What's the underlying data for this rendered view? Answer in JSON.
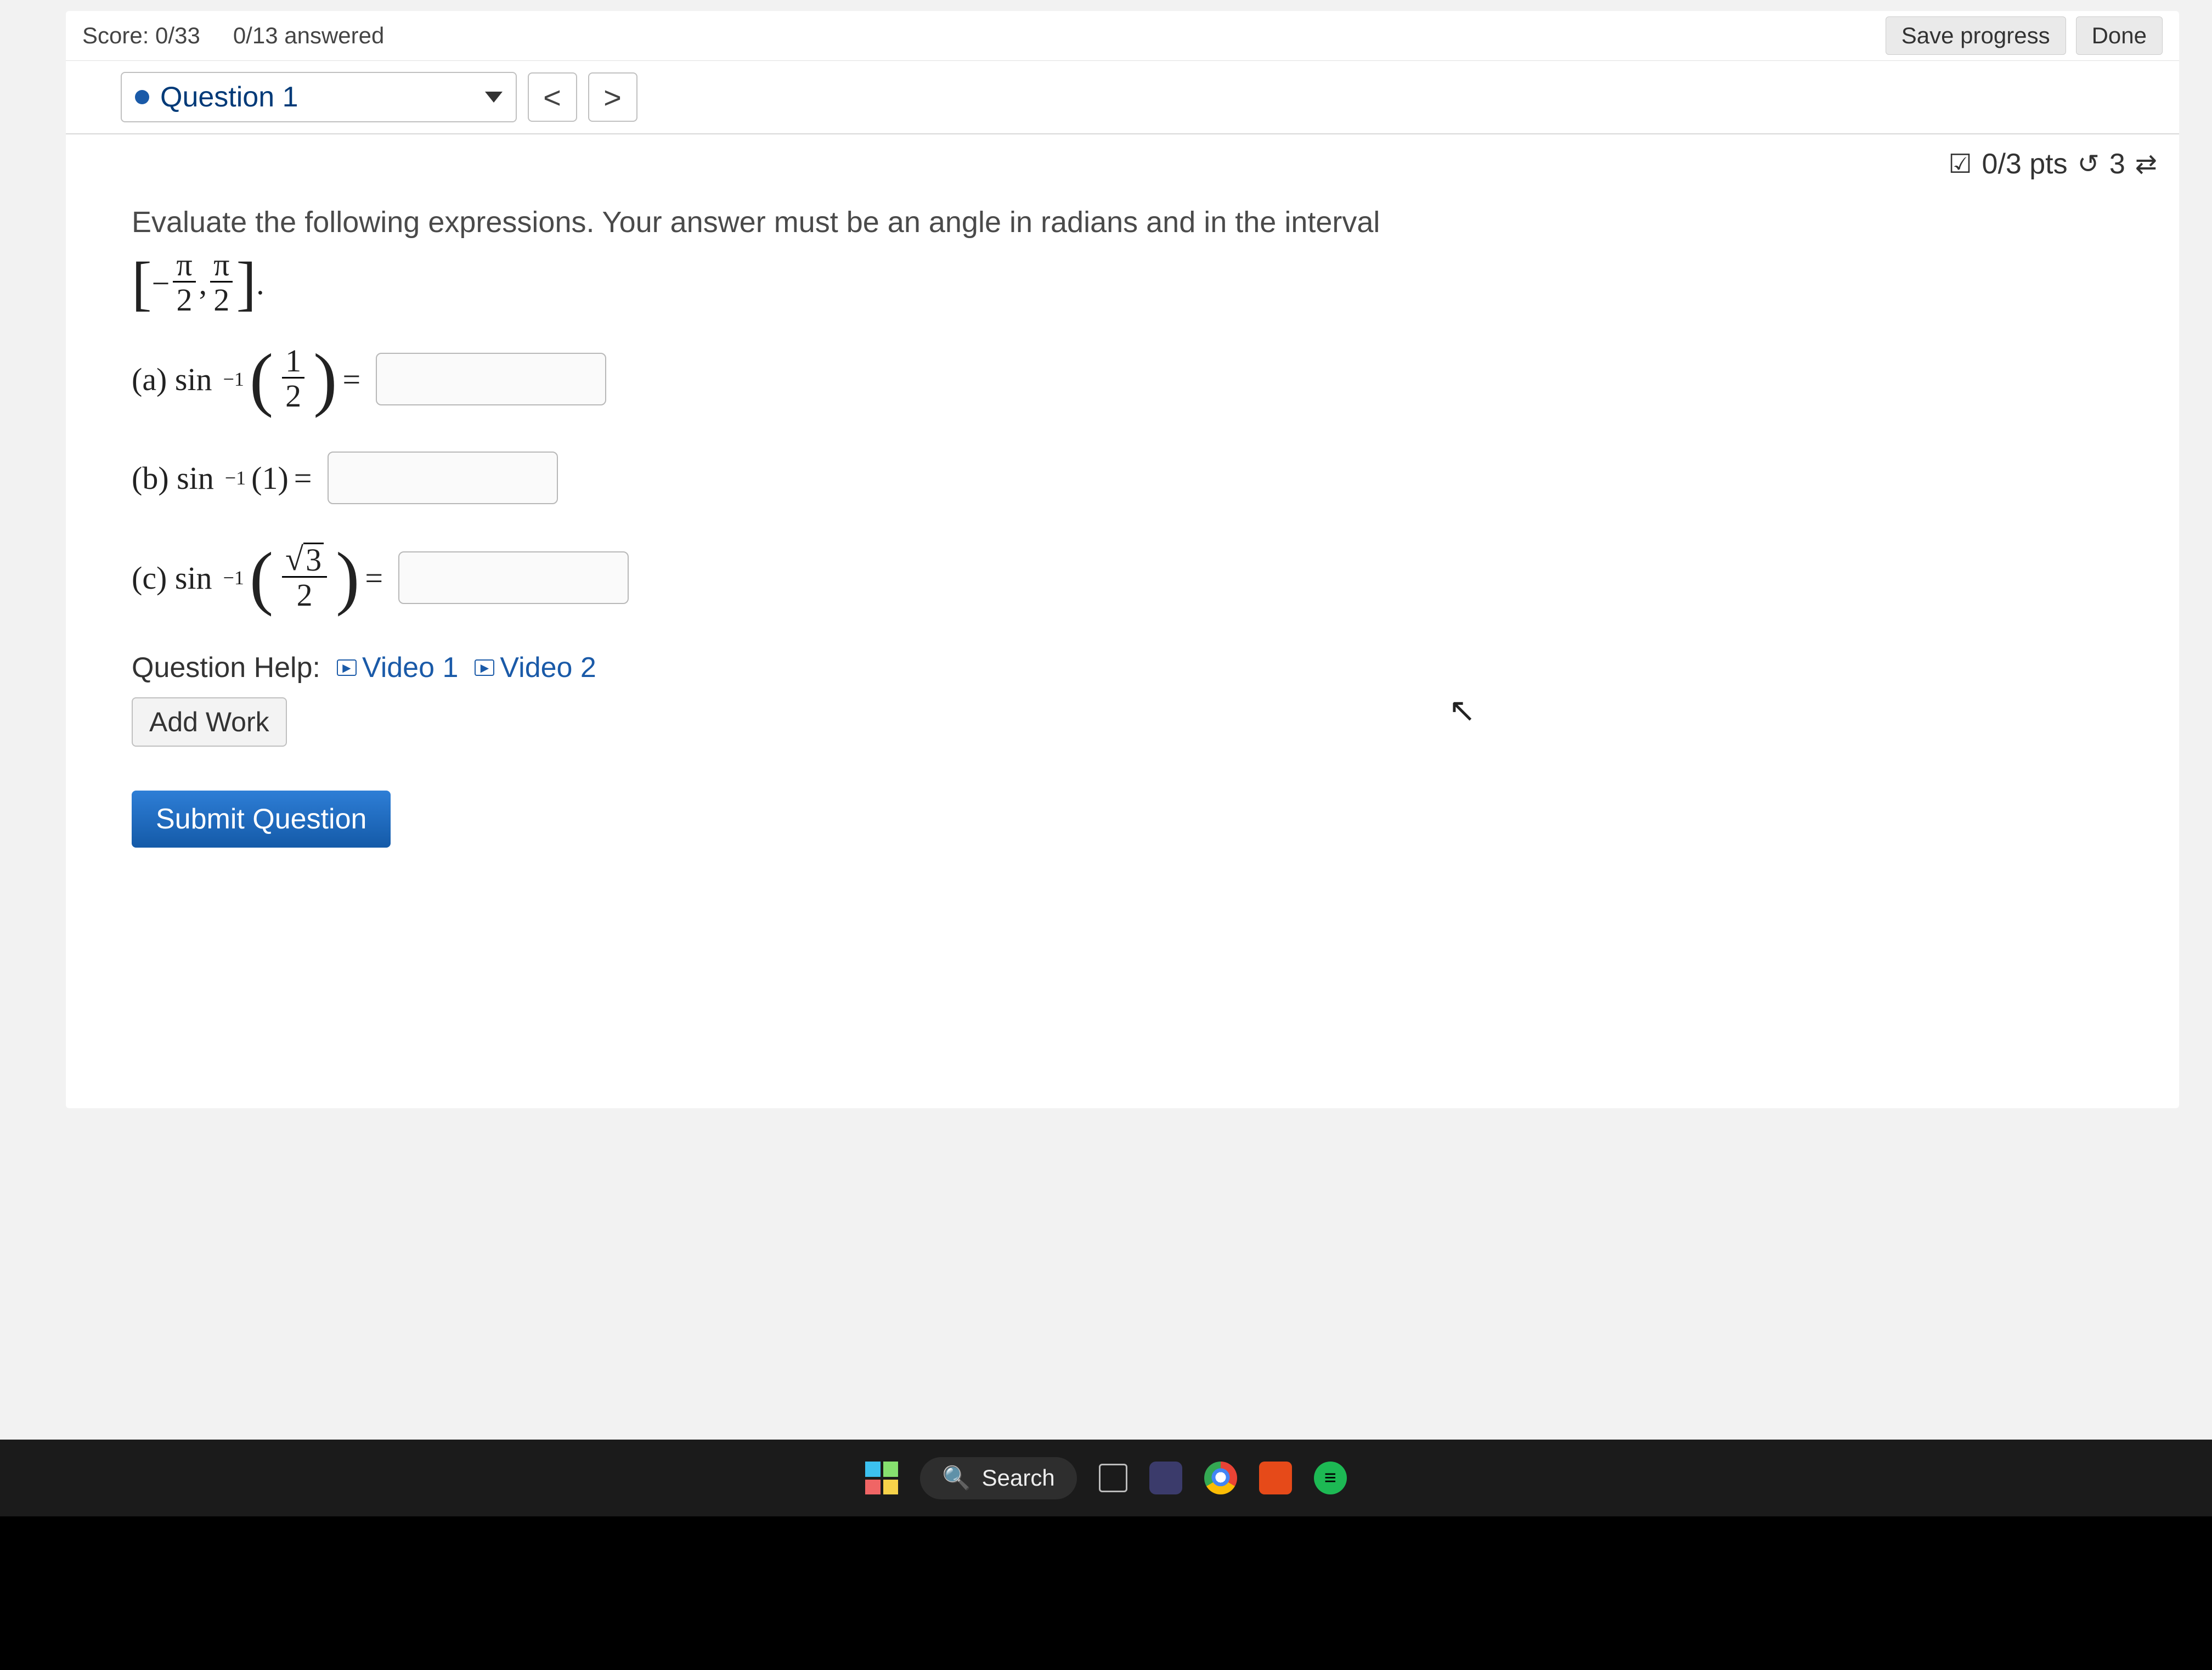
{
  "topbar": {
    "score_label": "Score: 0/33",
    "answered_label": "0/13 answered",
    "save_label": "Save progress",
    "done_label": "Done"
  },
  "question_nav": {
    "current_label": "Question 1",
    "prev": "<",
    "next": ">"
  },
  "points": {
    "checkbox_icon": "☑",
    "pts_text": "0/3 pts",
    "retry_icon": "↺",
    "retry_count": "3",
    "swap_icon": "⇄"
  },
  "prompt": {
    "line1": "Evaluate the following expressions. Your answer must be an angle in radians and in the interval",
    "interval_neg": "−",
    "interval_num": "π",
    "interval_den": "2",
    "interval_comma": ",",
    "interval_period": "."
  },
  "parts": {
    "a_label": "(a) sin",
    "a_sup": "−1",
    "a_frac_n": "1",
    "a_frac_d": "2",
    "eq": "=",
    "b_label": "(b) sin",
    "b_sup": "−1",
    "b_arg": "(1)",
    "c_label": "(c) sin",
    "c_sup": "−1",
    "c_frac_n_root": "3",
    "c_frac_d": "2"
  },
  "help": {
    "label": "Question Help:",
    "video1": "Video 1",
    "video2": "Video 2",
    "add_work": "Add Work"
  },
  "submit_label": "Submit Question",
  "taskbar": {
    "search_placeholder": "Search",
    "search_icon": "🔍"
  }
}
